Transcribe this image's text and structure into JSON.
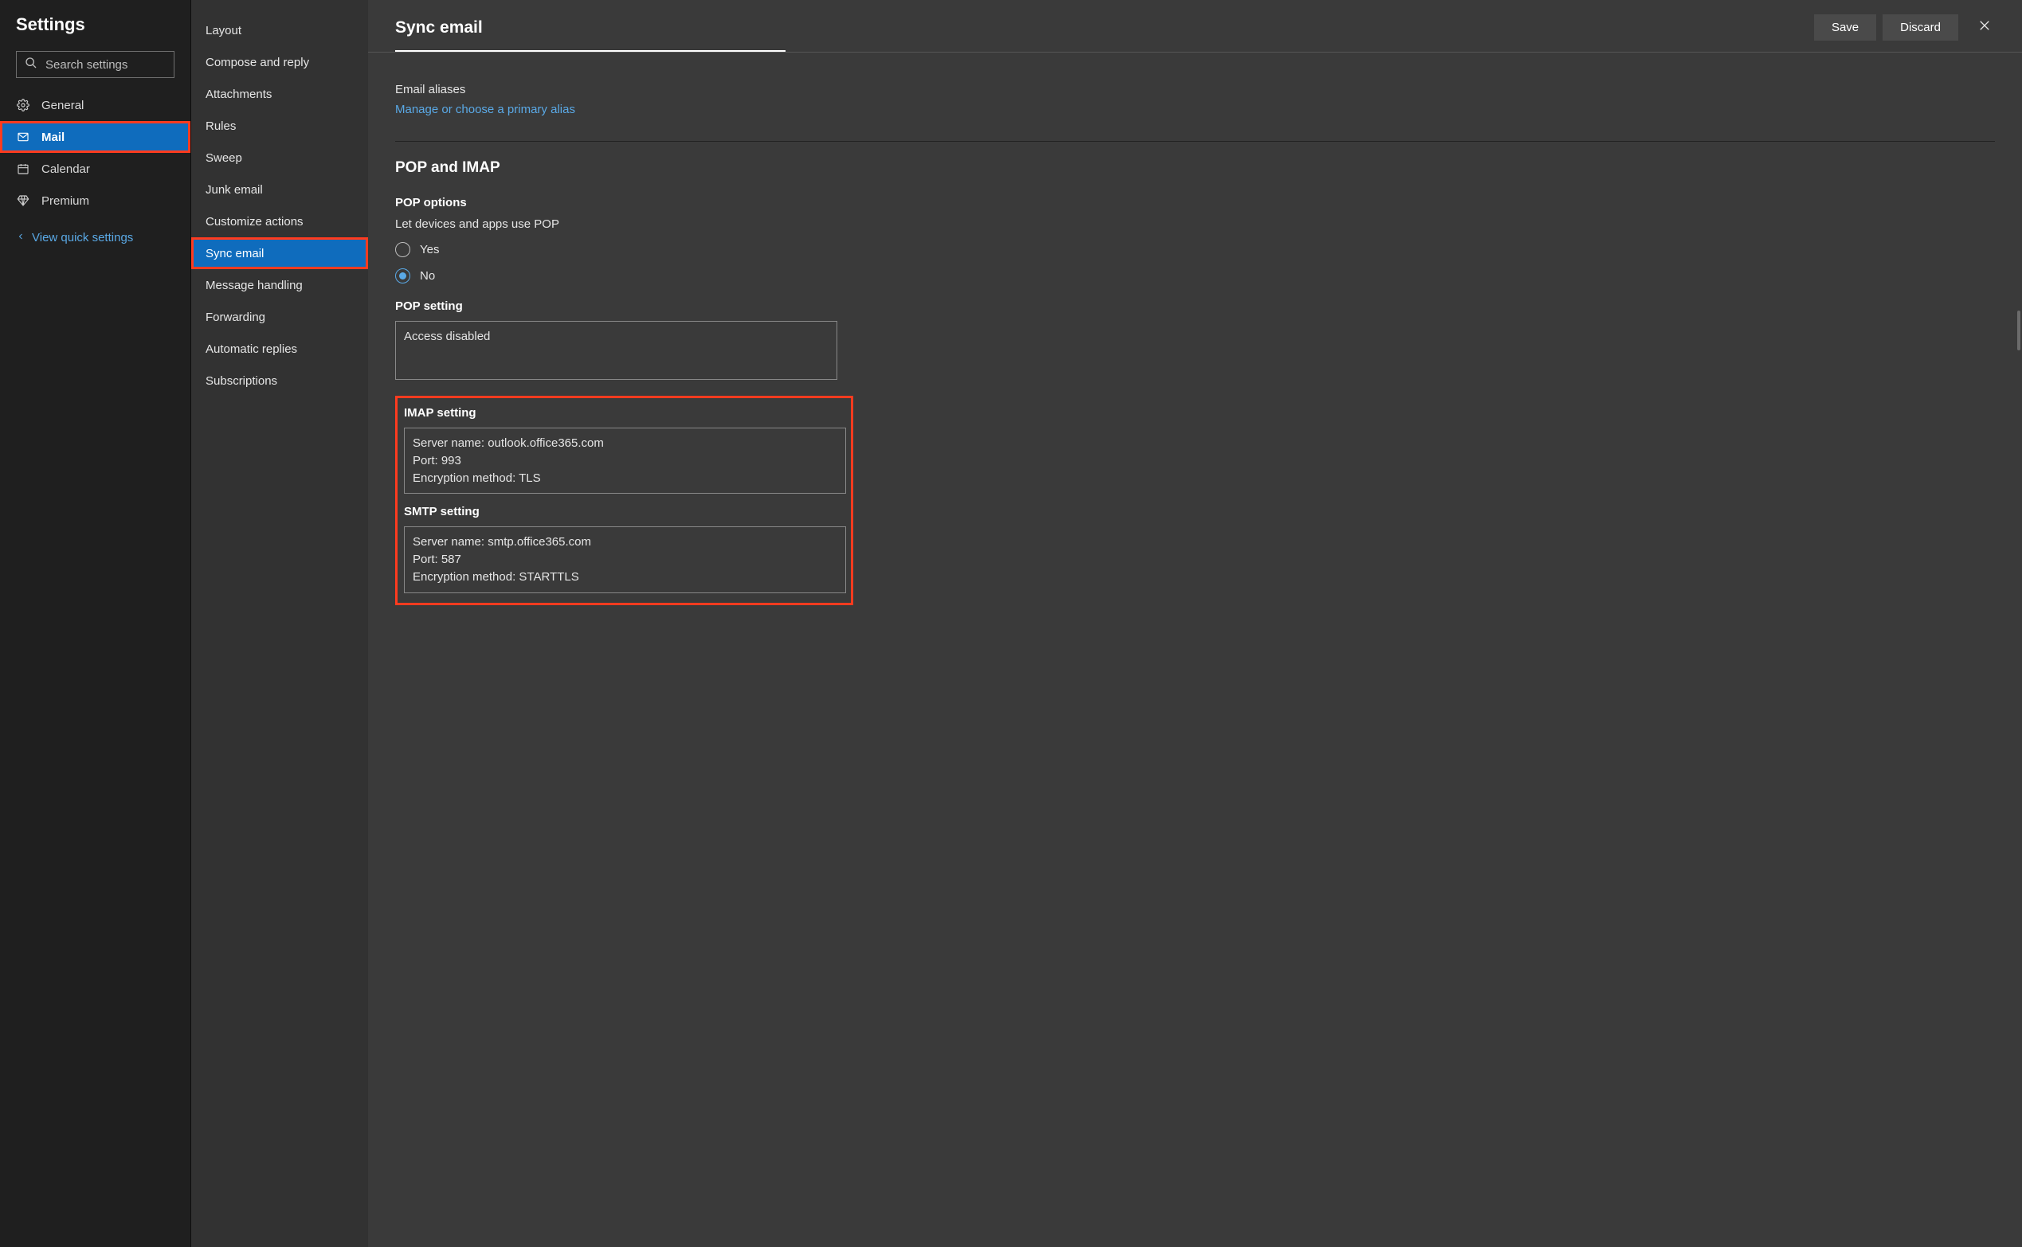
{
  "sidebar_left": {
    "title": "Settings",
    "search_placeholder": "Search settings",
    "categories": [
      {
        "label": "General",
        "icon": "gear"
      },
      {
        "label": "Mail",
        "icon": "mail"
      },
      {
        "label": "Calendar",
        "icon": "calendar"
      },
      {
        "label": "Premium",
        "icon": "diamond"
      }
    ],
    "active_category_index": 1,
    "quick_link": "View quick settings"
  },
  "sidebar_mid": {
    "items": [
      "Layout",
      "Compose and reply",
      "Attachments",
      "Rules",
      "Sweep",
      "Junk email",
      "Customize actions",
      "Sync email",
      "Message handling",
      "Forwarding",
      "Automatic replies",
      "Subscriptions"
    ],
    "active_index": 7
  },
  "header": {
    "title": "Sync email",
    "save_label": "Save",
    "discard_label": "Discard"
  },
  "content": {
    "aliases": {
      "label": "Email aliases",
      "link": "Manage or choose a primary alias"
    },
    "pop_imap": {
      "heading": "POP and IMAP",
      "pop_options_heading": "POP options",
      "pop_options_desc": "Let devices and apps use POP",
      "radio_yes": "Yes",
      "radio_no": "No",
      "selected": "No",
      "pop_setting_heading": "POP setting",
      "pop_setting_text": "Access disabled",
      "imap_setting_heading": "IMAP setting",
      "imap_server_name": "Server name: outlook.office365.com",
      "imap_port": "Port: 993",
      "imap_encryption": "Encryption method: TLS",
      "smtp_setting_heading": "SMTP setting",
      "smtp_server_name": "Server name: smtp.office365.com",
      "smtp_port": "Port: 587",
      "smtp_encryption": "Encryption method: STARTTLS"
    }
  }
}
